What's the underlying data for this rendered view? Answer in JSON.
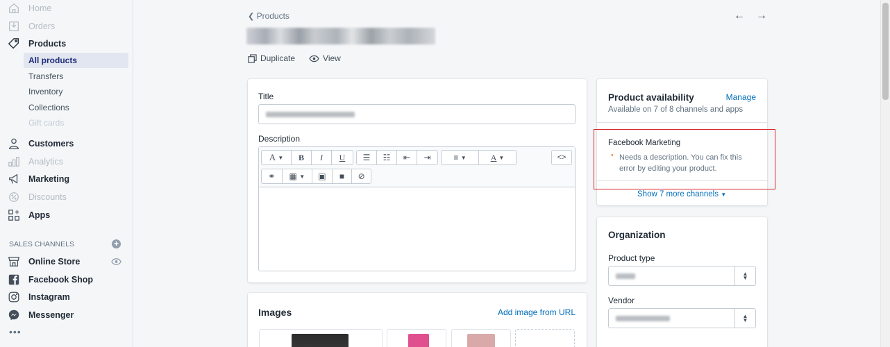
{
  "sidebar": {
    "items": [
      {
        "label": "Home",
        "icon": "home-icon",
        "disabled": true
      },
      {
        "label": "Orders",
        "icon": "orders-icon",
        "disabled": true
      },
      {
        "label": "Products",
        "icon": "tag-icon",
        "disabled": false
      },
      {
        "label": "Customers",
        "icon": "person-icon",
        "disabled": false
      },
      {
        "label": "Analytics",
        "icon": "bar-chart-icon",
        "disabled": true
      },
      {
        "label": "Marketing",
        "icon": "megaphone-icon",
        "disabled": false
      },
      {
        "label": "Discounts",
        "icon": "discount-icon",
        "disabled": true
      },
      {
        "label": "Apps",
        "icon": "apps-icon",
        "disabled": false
      }
    ],
    "product_sub": [
      {
        "label": "All products",
        "active": true
      },
      {
        "label": "Transfers"
      },
      {
        "label": "Inventory"
      },
      {
        "label": "Collections"
      },
      {
        "label": "Gift cards",
        "disabled": true
      }
    ],
    "sales_channels_heading": "SALES CHANNELS",
    "channels": [
      {
        "label": "Online Store",
        "icon": "store-icon"
      },
      {
        "label": "Facebook Shop",
        "icon": "facebook-icon"
      },
      {
        "label": "Instagram",
        "icon": "instagram-icon"
      },
      {
        "label": "Messenger",
        "icon": "messenger-icon"
      }
    ],
    "more": "•••"
  },
  "header": {
    "back_label": "Products",
    "actions": {
      "duplicate": "Duplicate",
      "view": "View"
    },
    "prev_arrow": "←",
    "next_arrow": "→"
  },
  "product_form": {
    "title_label": "Title",
    "description_label": "Description",
    "toolbar": {
      "font": "A",
      "bold": "B",
      "italic": "I",
      "underline": "U",
      "code": "<>"
    }
  },
  "images": {
    "heading": "Images",
    "add_from_url": "Add image from URL"
  },
  "availability": {
    "heading": "Product availability",
    "manage": "Manage",
    "summary": "Available on 7 of 8 channels and apps",
    "channel_name": "Facebook Marketing",
    "error": "Needs a description. You can fix this error by editing your product.",
    "show_more": "Show 7 more channels"
  },
  "organization": {
    "heading": "Organization",
    "product_type_label": "Product type",
    "vendor_label": "Vendor"
  },
  "colors": {
    "accent": "#006fbb",
    "error_outline": "#d6262a",
    "warning_bullet": "#f49342"
  }
}
